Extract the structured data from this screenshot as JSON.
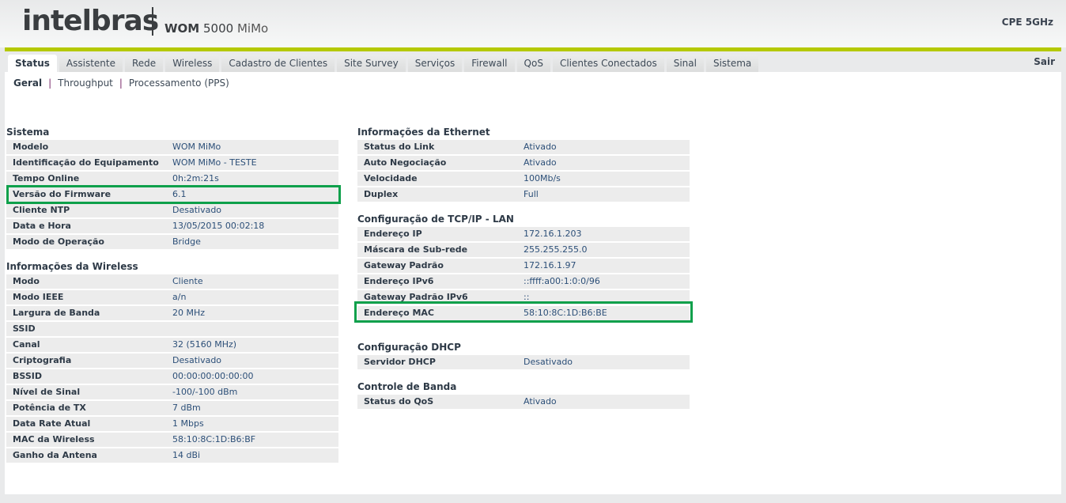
{
  "header": {
    "logo": "intelbras",
    "model_bold": "WOM",
    "model_num": "5000",
    "model_name": "MiMo",
    "device_type": "CPE 5GHz"
  },
  "colors": {
    "accent": "#b5c900",
    "highlight": "#0ea04b"
  },
  "tabs": [
    "Status",
    "Assistente",
    "Rede",
    "Wireless",
    "Cadastro de Clientes",
    "Site Survey",
    "Serviços",
    "Firewall",
    "QoS",
    "Clientes Conectados",
    "Sinal",
    "Sistema"
  ],
  "active_tab": "Status",
  "logout": "Sair",
  "subnav": {
    "geral": "Geral",
    "sep": "|",
    "throughput": "Throughput",
    "pps": "Processamento (PPS)"
  },
  "sections": {
    "sistema": {
      "title": "Sistema",
      "rows": [
        [
          "Modelo",
          "WOM MiMo"
        ],
        [
          "Identificação do Equipamento",
          "WOM MiMo - TESTE"
        ],
        [
          "Tempo Online",
          "0h:2m:21s"
        ],
        [
          "Versão do Firmware",
          "6.1"
        ],
        [
          "Cliente NTP",
          "Desativado"
        ],
        [
          "Data e Hora",
          "13/05/2015 00:02:18"
        ],
        [
          "Modo de Operação",
          "Bridge"
        ]
      ]
    },
    "wireless": {
      "title": "Informações da Wireless",
      "rows": [
        [
          "Modo",
          "Cliente"
        ],
        [
          "Modo IEEE",
          "a/n"
        ],
        [
          "Largura de Banda",
          "20 MHz"
        ],
        [
          "SSID",
          ""
        ],
        [
          "Canal",
          "32 (5160 MHz)"
        ],
        [
          "Criptografia",
          "Desativado"
        ],
        [
          "BSSID",
          "00:00:00:00:00:00"
        ],
        [
          "Nível de Sinal",
          "-100/-100 dBm"
        ],
        [
          "Potência de TX",
          "7 dBm"
        ],
        [
          "Data Rate Atual",
          "1 Mbps"
        ],
        [
          "MAC da Wireless",
          "58:10:8C:1D:B6:BF"
        ],
        [
          "Ganho da Antena",
          "14 dBi"
        ]
      ]
    },
    "ethernet": {
      "title": "Informações da Ethernet",
      "rows": [
        [
          "Status do Link",
          "Ativado"
        ],
        [
          "Auto Negociação",
          "Ativado"
        ],
        [
          "Velocidade",
          "100Mb/s"
        ],
        [
          "Duplex",
          "Full"
        ]
      ]
    },
    "tcpip": {
      "title": "Configuração de TCP/IP - LAN",
      "rows": [
        [
          "Endereço IP",
          "172.16.1.203"
        ],
        [
          "Máscara de Sub-rede",
          "255.255.255.0"
        ],
        [
          "Gateway Padrão",
          "172.16.1.97"
        ],
        [
          "Endereço IPv6",
          "::ffff:a00:1:0:0/96"
        ],
        [
          "Gateway Padrão IPv6",
          "::"
        ],
        [
          "Endereço MAC",
          "58:10:8C:1D:B6:BE"
        ]
      ]
    },
    "dhcp": {
      "title": "Configuração DHCP",
      "rows": [
        [
          "Servidor DHCP",
          "Desativado"
        ]
      ]
    },
    "banda": {
      "title": "Controle de Banda",
      "rows": [
        [
          "Status do QoS",
          "Ativado"
        ]
      ]
    }
  }
}
